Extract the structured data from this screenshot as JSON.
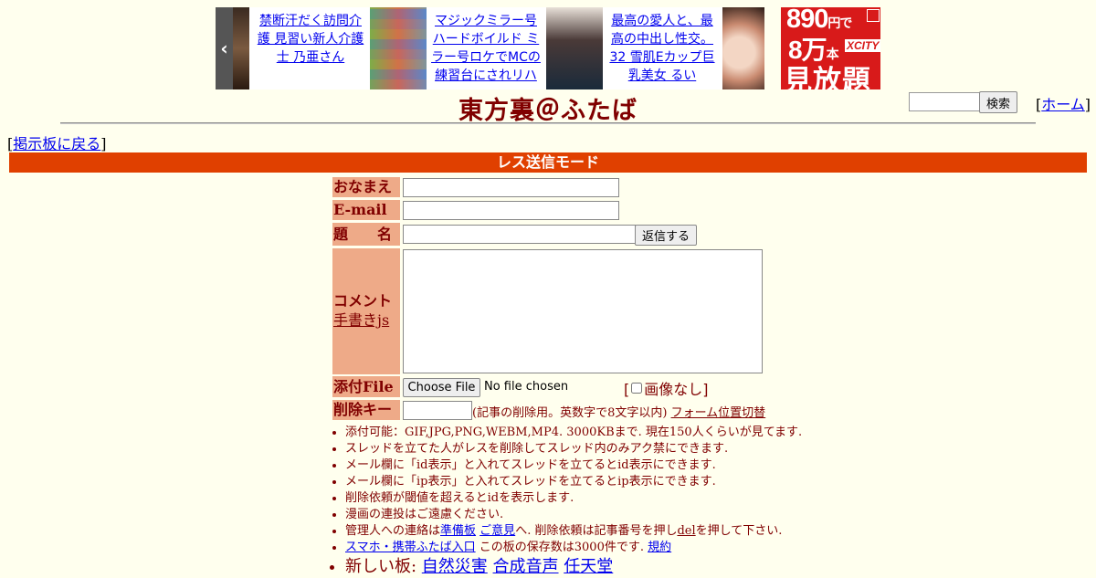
{
  "ads": {
    "left_arrow": "‹",
    "right_arrow": "›",
    "items": [
      {
        "text": "禁断汗だく訪問介護 見習い新人介護士 乃亜さん"
      },
      {
        "text": "マジックミラー号 ハードボイルド ミラー号ロケでMCの練習台にされリハ"
      },
      {
        "text": "最高の愛人と、最高の中出し性交。 32 雪肌Eカップ巨乳美女 るい"
      }
    ],
    "xcity": {
      "price": "890",
      "price_unit": "円で",
      "count": "8万",
      "count_unit": "本",
      "brand": "XCITY",
      "tagline": "見放題"
    }
  },
  "header": {
    "title": "東方裏＠ふたば",
    "search_button": "検索",
    "home_link": "ホーム",
    "back_link": "掲示板に戻る"
  },
  "mode_bar": "レス送信モード",
  "form": {
    "name_label": "おなまえ",
    "email_label": "E-mail",
    "subject_label": "題　　名",
    "reply_button": "返信する",
    "comment_label": "コメント",
    "handwriting_link": "手書きjs",
    "file_label": "添付File",
    "choose_file_button": "Choose File",
    "no_file_text": "No file chosen",
    "no_image_label": "画像なし",
    "delete_key_label": "削除キー",
    "delete_key_note": "(記事の削除用。英数字で8文字以内)",
    "form_position_link": "フォーム位置切替"
  },
  "notes": {
    "n1": "添付可能：GIF,JPG,PNG,WEBM,MP4. 3000KBまで. 現在150人くらいが見てます.",
    "n2": "スレッドを立てた人がレスを削除してスレッド内のみアク禁にできます.",
    "n3": "メール欄に「id表示」と入れてスレッドを立てるとid表示にできます.",
    "n4": "メール欄に「ip表示」と入れてスレッドを立てるとip表示にできます.",
    "n5": "削除依頼が閾値を超えるとidを表示します.",
    "n6": "漫画の連投はご遠慮ください.",
    "n7_prefix": "管理人への連絡は",
    "n7_link1": "準備板",
    "n7_link2": "ご意見",
    "n7_mid": "へ. 削除依頼は記事番号を押し",
    "n7_link3": "del",
    "n7_suffix": "を押して下さい.",
    "n8_link": "スマホ・携帯ふたば入口",
    "n8_mid": " この板の保存数は3000件です. ",
    "n8_link2": "規約",
    "n9_prefix": "新しい板: ",
    "n9_links": [
      "自然災害",
      "合成音声",
      "任天堂"
    ]
  },
  "colors": {
    "background": "#ffffee",
    "text": "#800000",
    "mode_bar": "#e04000",
    "label_bg": "#eeaa88",
    "xcity_red": "#d81a1a"
  }
}
